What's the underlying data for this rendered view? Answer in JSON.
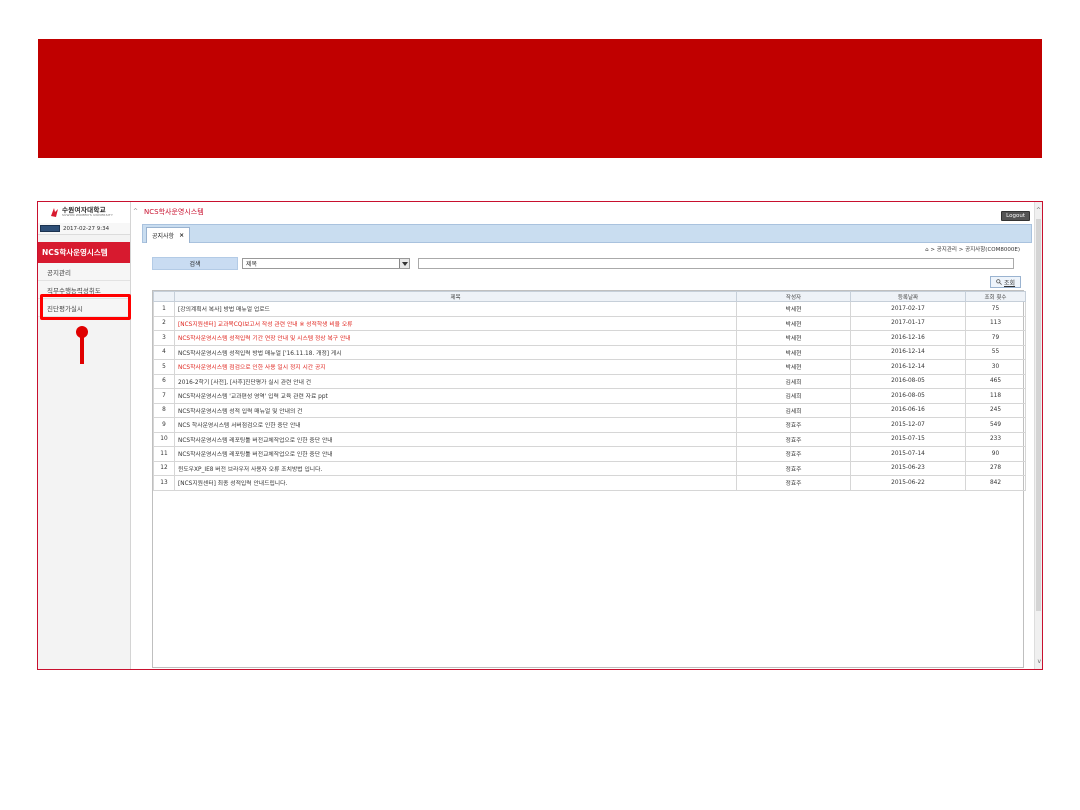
{
  "window": {
    "app_name": "NCS학사운영시스템",
    "logout_label": "Logout"
  },
  "sidebar": {
    "logo_ko": "수원여자대학교",
    "logo_en": "SUWON WOMEN'S UNIVERSITY",
    "datetime": "2017-02-27 9:34",
    "system_title": "NCS학사운영시스템",
    "items": [
      {
        "label": "공지관리"
      },
      {
        "label": "직무수행능력성취도"
      },
      {
        "label": "진단평가실시"
      }
    ]
  },
  "tabs": [
    {
      "label": "공지사항"
    }
  ],
  "breadcrumb": "⌂ > 공지관리 > 공지사항(COM8000E)",
  "search": {
    "label": "검색",
    "selected": "제목",
    "value": "",
    "query_label": "조회"
  },
  "table": {
    "headers": {
      "no": "",
      "title": "제목",
      "author": "작성자",
      "date": "등록날짜",
      "views": "조회 횟수"
    },
    "rows": [
      {
        "no": "1",
        "title": "[강의계획서 복사] 방법 매뉴얼 업로드",
        "author": "박세현",
        "date": "2017-02-17",
        "views": "75",
        "red": false
      },
      {
        "no": "2",
        "title": "[NCS지원센터] 교과목CQI보고서 작성 관련 안내 ※ 성적학생 비율 오류",
        "author": "박세현",
        "date": "2017-01-17",
        "views": "113",
        "red": true
      },
      {
        "no": "3",
        "title": "NCS학사운영시스템 성적입력 기간 연장 안내 및 시스템 정상 복구 안내",
        "author": "박세현",
        "date": "2016-12-16",
        "views": "79",
        "red": true
      },
      {
        "no": "4",
        "title": "NCS학사운영시스템 성적입력 방법 매뉴얼 ['16.11.18. 개정] 게시",
        "author": "박세현",
        "date": "2016-12-14",
        "views": "55",
        "red": false
      },
      {
        "no": "5",
        "title": "NCS학사운영시스템 점검으로 인한 사용 일시 정지 시간 공지",
        "author": "박세현",
        "date": "2016-12-14",
        "views": "30",
        "red": true
      },
      {
        "no": "6",
        "title": "2016-2학기 [사전], [사후]진단평가 실시 관련 안내 건",
        "author": "김세희",
        "date": "2016-08-05",
        "views": "465",
        "red": false
      },
      {
        "no": "7",
        "title": "NCS학사운영시스템 '교과편성 영역' 입력 교육 관련 자료 ppt",
        "author": "김세희",
        "date": "2016-08-05",
        "views": "118",
        "red": false
      },
      {
        "no": "8",
        "title": "NCS학사운영시스템 성적 입력 매뉴얼 및 안내의 건",
        "author": "김세희",
        "date": "2016-06-16",
        "views": "245",
        "red": false
      },
      {
        "no": "9",
        "title": "NCS 학사운영시스템 서버점검으로 인한 중단 안내",
        "author": "정효주",
        "date": "2015-12-07",
        "views": "549",
        "red": false
      },
      {
        "no": "10",
        "title": "NCS학사운영시스템 레포팅툴 버전교체작업으로 인한 중단 안내",
        "author": "정효주",
        "date": "2015-07-15",
        "views": "233",
        "red": false
      },
      {
        "no": "11",
        "title": "NCS학사운영시스템 레포팅툴 버전교체작업으로 인한 중단 안내",
        "author": "정효주",
        "date": "2015-07-14",
        "views": "90",
        "red": false
      },
      {
        "no": "12",
        "title": "윈도우XP_IE8 버전 브라우저 사용자 오류 조치방법 입니다.",
        "author": "정효주",
        "date": "2015-06-23",
        "views": "278",
        "red": false
      },
      {
        "no": "13",
        "title": "[NCS지원센터] 최종 성적입력 안내드립니다.",
        "author": "정효주",
        "date": "2015-06-22",
        "views": "842",
        "red": false
      }
    ]
  },
  "colors": {
    "banner": "#c00000",
    "system_title_bg": "#d71a2f",
    "highlight_box": "#ff0000",
    "notice_red_text": "#e0261f"
  },
  "icons": {
    "home": "home-icon",
    "search": "magnifier-icon",
    "close": "close-icon",
    "dropdown": "chevron-down-icon"
  }
}
